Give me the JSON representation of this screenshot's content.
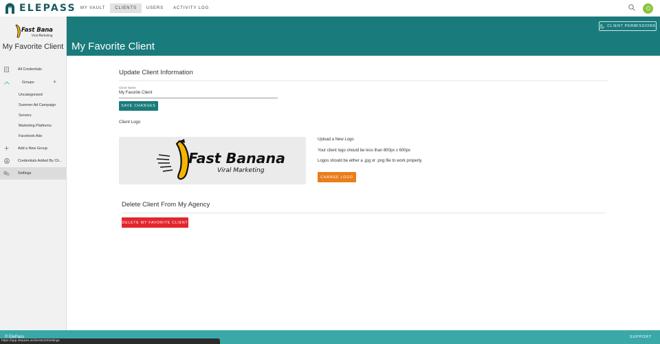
{
  "brand": {
    "name": "ELEPASS"
  },
  "nav": {
    "items": [
      {
        "label": "MY VAULT",
        "active": false
      },
      {
        "label": "CLIENTS",
        "active": true
      },
      {
        "label": "USERS",
        "active": false
      },
      {
        "label": "ACTIVITY LOG",
        "active": false
      }
    ]
  },
  "sidebar": {
    "client_name": "My Favorite Client",
    "items": {
      "all_credentials": "All Credentials",
      "groups": "Groups",
      "group_items": [
        "Uncategorized",
        "Summer Ad Campaign",
        "Servers",
        "Marketing Platforms",
        "Facebook Ads"
      ],
      "add_group": "Add a New Group",
      "credentials_added": "Credentials Added By Cli...",
      "settings": "Settings"
    }
  },
  "logo": {
    "line1": "Fast Banana",
    "line2": "Viral Marketing"
  },
  "header": {
    "title": "My Favorite Client",
    "permissions_button": "CLIENT PERMISSIONS"
  },
  "update_section": {
    "title": "Update Client Information",
    "field_label": "Client Name",
    "field_value": "My Favorite Client",
    "save_button": "SAVE CHANGES",
    "logo_caption": "Client Logo"
  },
  "upload_info": {
    "heading": "Upload a New Logo",
    "size_note": "Your client logo should be less than 800px x 600px",
    "format_note": "Logos should be either a .jpg or .png file to work properly.",
    "change_button": "CHANGE LOGO"
  },
  "delete_section": {
    "title": "Delete Client From My Agency",
    "delete_button": "DELETE MY FAVORITE CLIENT"
  },
  "footer": {
    "copyright": "© ElePass",
    "support": "SUPPORT"
  },
  "status_url": "https://app.elepass.io/clients/10/settings",
  "colors": {
    "teal": "#1a7b7c",
    "footer_teal": "#3aa8a7",
    "orange": "#ea7d1c",
    "red": "#e3262e",
    "avatar_green": "#8dc43b"
  }
}
